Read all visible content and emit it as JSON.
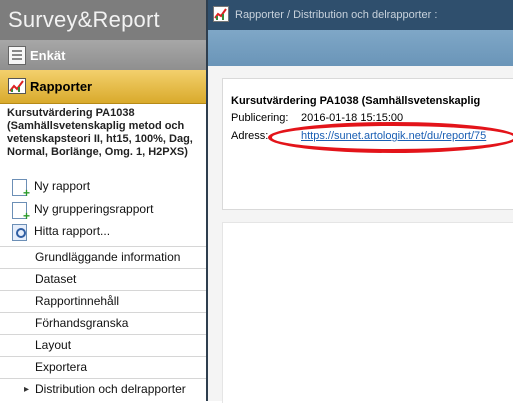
{
  "app": {
    "logo": "Survey&Report"
  },
  "nav": {
    "enkat": "Enkät",
    "rapporter": "Rapporter"
  },
  "report": {
    "title": "Kursutvärdering PA1038 (Samhällsvetenskaplig metod och vetenskapsteori II, ht15, 100%, Dag, Normal, Borlänge, Omg. 1, H2PXS)"
  },
  "actions": [
    {
      "label": "Ny rapport",
      "icon": "new-report-icon"
    },
    {
      "label": "Ny grupperingsrapport",
      "icon": "new-group-report-icon"
    },
    {
      "label": "Hitta rapport...",
      "icon": "find-report-icon"
    }
  ],
  "menu": [
    {
      "label": "Grundläggande information"
    },
    {
      "label": "Dataset"
    },
    {
      "label": "Rapportinnehåll"
    },
    {
      "label": "Förhandsgranska"
    },
    {
      "label": "Layout"
    },
    {
      "label": "Exportera"
    },
    {
      "label": "Distribution och delrapporter",
      "active": true
    }
  ],
  "breadcrumb": "Rapporter / Distribution och delrapporter :",
  "panel": {
    "title": "Kursutvärdering PA1038 (Samhällsvetenskaplig",
    "publicering_label": "Publicering:",
    "publicering_value": "2016-01-18 15:15:00",
    "adress_label": "Adress:",
    "adress_value": "https://sunet.artologik.net/du/report/75"
  },
  "colors": {
    "sidebar_header": "#7d7d7d",
    "rapporter_accent": "#e2b83f",
    "topbar": "#2f4f6d",
    "band": "#76a0c2",
    "link": "#1a5fb4",
    "highlight": "#e3141a"
  }
}
